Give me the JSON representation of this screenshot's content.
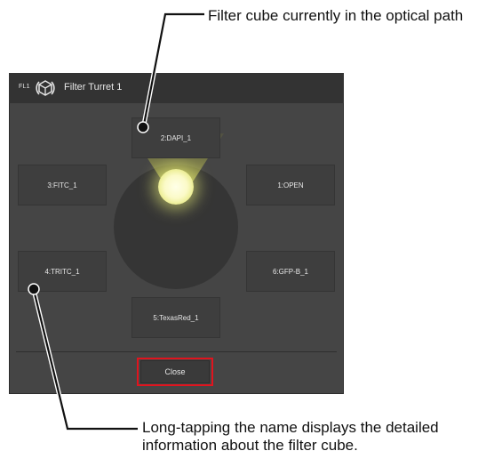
{
  "annotations": {
    "top": "Filter cube currently in the optical path",
    "bottom": "Long-tapping the name displays the detailed information about the filter cube."
  },
  "dialog": {
    "badge": "FL1",
    "title": "Filter Turret 1",
    "turret_icon": "filter-turret-icon",
    "close_label": "Close"
  },
  "filters": {
    "pos1": "1:OPEN",
    "pos2": "2:DAPI_1",
    "pos3": "3:FITC_1",
    "pos4": "4:TRITC_1",
    "pos5": "5:TexasRed_1",
    "pos6": "6:GFP-B_1"
  },
  "colors": {
    "dialog_bg": "#454545",
    "titlebar_bg": "#333333",
    "highlight": "#e0141e",
    "light_beam": "#e9eb8a"
  }
}
